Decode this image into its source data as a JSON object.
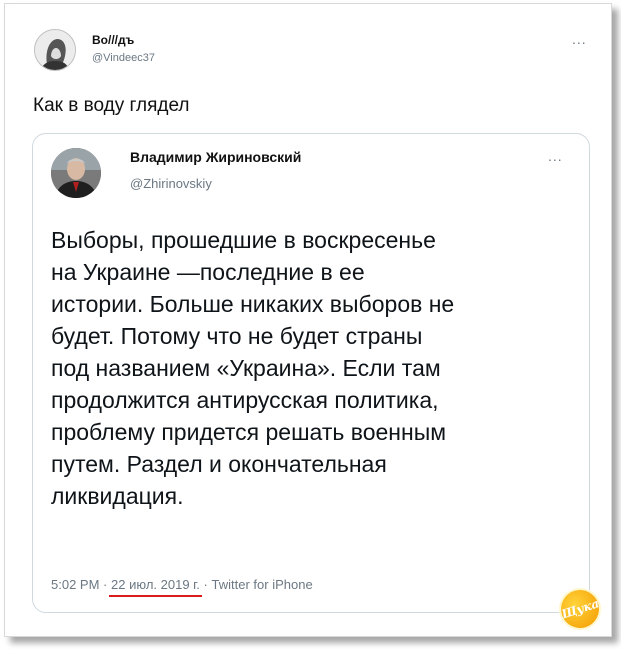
{
  "outer_tweet": {
    "display_name": "Во///дъ",
    "handle": "@Vindeec37",
    "more_label": "...",
    "text": "Как в воду глядел"
  },
  "quoted_tweet": {
    "display_name": "Владимир Жириновский",
    "handle": "@Zhirinovskiy",
    "more_label": "...",
    "text_lines": [
      "Выборы, прошедшие в воскресенье",
      "на Украине —последние в ее",
      "истории. Больше никаких выборов не",
      "будет. Потому что не будет страны",
      "под названием «Украина». Если там",
      "продолжится антирусская политика,",
      "проблему придется решать военным",
      "путем. Раздел и окончательная",
      "ликвидация."
    ],
    "time": "5:02 PM",
    "separator": "·",
    "date": "22 июл. 2019 г.",
    "source": "Twitter for iPhone",
    "date_underline_color": "#d81b1b"
  },
  "watermark": {
    "text": "Щука"
  },
  "icons": {
    "outer_avatar": "portrait-sketch-avatar",
    "inner_avatar": "portrait-photo-avatar",
    "more": "more-options-icon",
    "watermark": "site-logo-badge"
  }
}
